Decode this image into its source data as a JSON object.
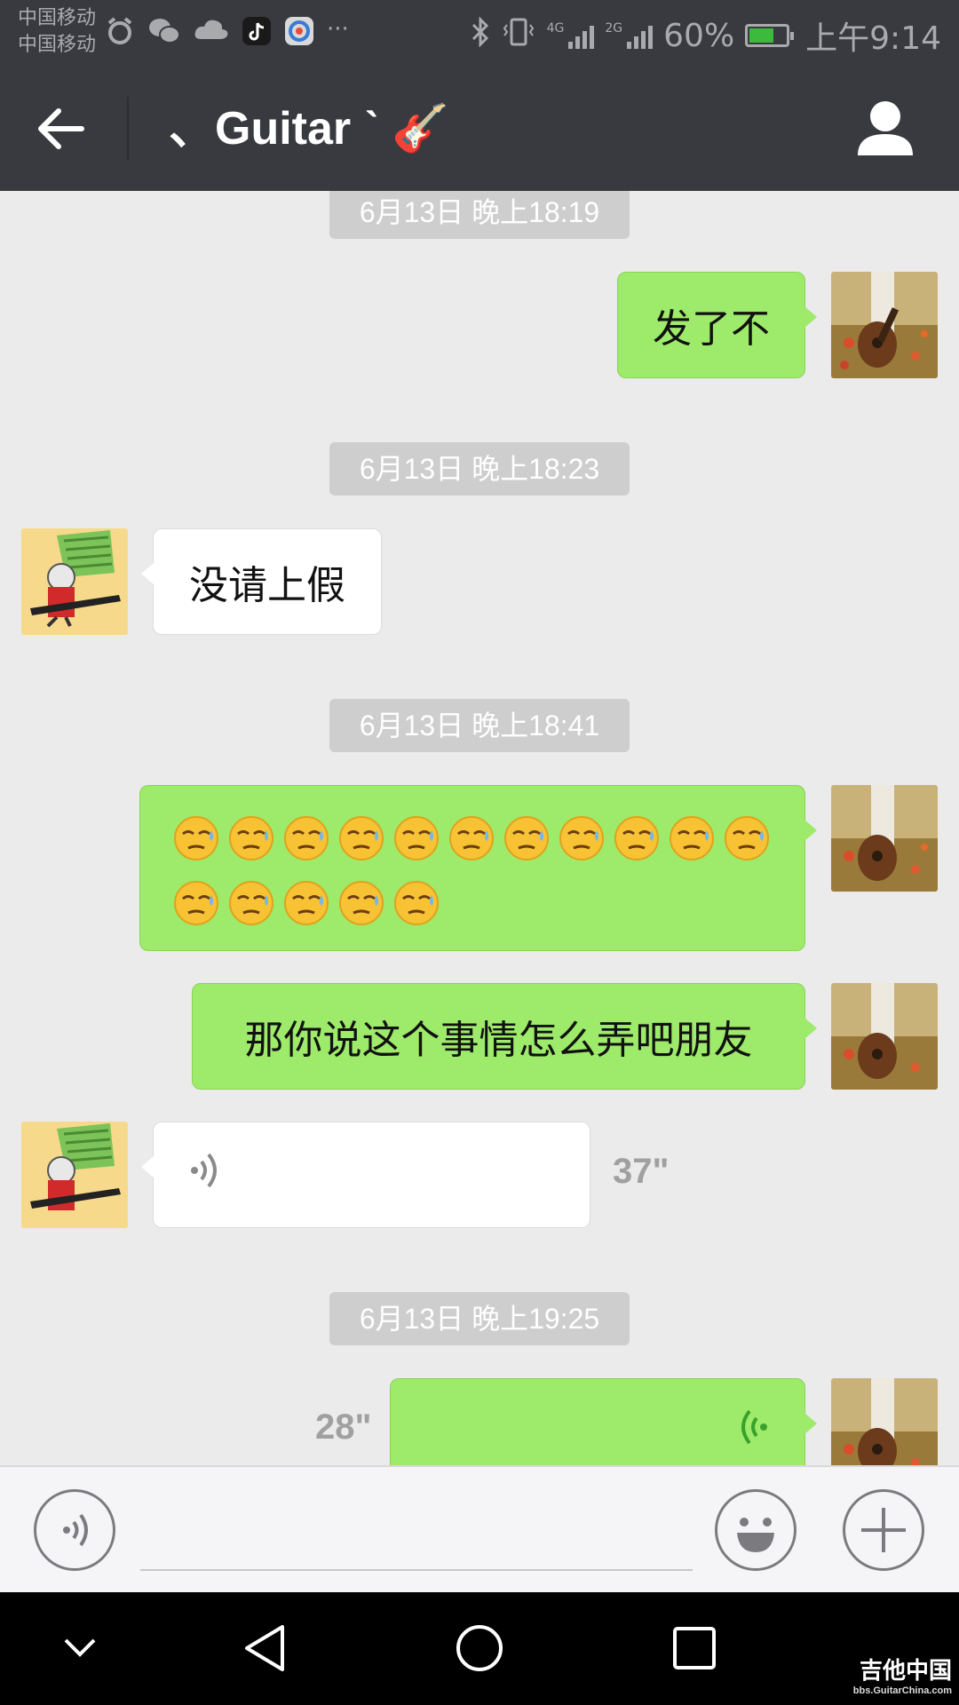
{
  "status_bar": {
    "carrier_1": "中国移动",
    "carrier_2": "中国移动",
    "network_1": "4G",
    "network_2": "2G",
    "battery": "60%",
    "time": "上午9:14",
    "more": "···"
  },
  "header": {
    "title": "、Guitar ˋ 🎸",
    "back_icon": "arrow-left-icon",
    "profile_icon": "person-icon"
  },
  "messages": [
    {
      "type": "timestamp",
      "text": "6月13日 晚上18:19"
    },
    {
      "type": "text",
      "side": "right",
      "text": "发了不"
    },
    {
      "type": "timestamp",
      "text": "6月13日 晚上18:23"
    },
    {
      "type": "text",
      "side": "left",
      "text": "没请上假"
    },
    {
      "type": "timestamp",
      "text": "6月13日 晚上18:41"
    },
    {
      "type": "emoji",
      "side": "right",
      "emoji": "😓",
      "count": 16
    },
    {
      "type": "text",
      "side": "right",
      "text": "那你说这个事情怎么弄吧朋友"
    },
    {
      "type": "voice",
      "side": "left",
      "duration": "37\""
    },
    {
      "type": "timestamp",
      "text": "6月13日 晚上19:25"
    },
    {
      "type": "voice",
      "side": "right",
      "duration": "28\""
    }
  ],
  "input_bar": {
    "voice_icon": "voice-mode-icon",
    "emoji_icon": "smiley-icon",
    "plus_icon": "plus-icon"
  },
  "nav_bar": {
    "down_icon": "chevron-down-icon",
    "back_icon": "triangle-back-icon",
    "home_icon": "circle-home-icon",
    "recent_icon": "square-recent-icon"
  },
  "watermark": {
    "main": "吉他中国",
    "sub": "bbs.GuitarChina.com"
  },
  "colors": {
    "bar": "#393a3f",
    "bubble_green": "#9eea6a",
    "background": "#ebebeb",
    "timestamp_bg": "#cecece"
  }
}
